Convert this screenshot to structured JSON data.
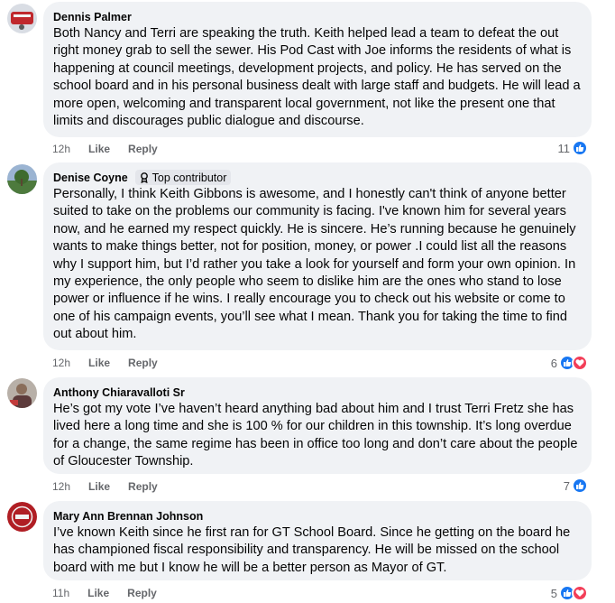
{
  "comments": [
    {
      "author": "Dennis Palmer",
      "badge": "",
      "text": "Both Nancy and Terri are speaking the truth. Keith helped lead a team to defeat the out right money grab to sell the sewer. His Pod Cast with Joe informs the residents of what is happening at council meetings, development projects, and policy. He has served on the school board and in his personal business dealt with large staff and budgets. He will lead a more open, welcoming and transparent local government, not like the present one that limits and discourages public dialogue and discourse.",
      "time": "12h",
      "like_label": "Like",
      "reply_label": "Reply",
      "reaction_count": "11",
      "reactions": [
        "like-icon"
      ]
    },
    {
      "author": "Denise Coyne",
      "badge": "Top contributor",
      "text": "Personally, I think Keith Gibbons is awesome, and I honestly can't think of anyone better suited to take on the problems our community is facing. I've known him for several years now, and he earned my respect quickly. He is sincere. He’s running because he genuinely wants to make things better, not for position, money, or power .I could list all the reasons why I support him, but I’d rather you take a look for yourself and form your own opinion. In my experience, the only people who seem to dislike him are the ones who stand to lose power or influence if he wins. I really encourage you to check out his website or come to one of his campaign events, you’ll see what I mean. Thank you for taking the time to find out about him.",
      "time": "12h",
      "like_label": "Like",
      "reply_label": "Reply",
      "reaction_count": "6",
      "reactions": [
        "like-icon",
        "love-icon"
      ]
    },
    {
      "author": "Anthony Chiaravalloti Sr",
      "badge": "",
      "text": "He’s got my vote I’ve haven’t heard anything bad about him and I trust Terri Fretz she has lived here a long time and she is 100 % for our children in this township. It’s long overdue for a change, the same regime has been in office too long and don’t care about the people of Gloucester Township.",
      "time": "12h",
      "like_label": "Like",
      "reply_label": "Reply",
      "reaction_count": "7",
      "reactions": [
        "like-icon"
      ]
    },
    {
      "author": "Mary Ann Brennan Johnson",
      "badge": "",
      "text": "I’ve known Keith since he first ran for GT School Board. Since he getting on the board he has championed fiscal responsibility and transparency. He will be missed on the school board with me but I know he will be a better person as Mayor of GT.",
      "time": "11h",
      "like_label": "Like",
      "reply_label": "Reply",
      "reaction_count": "5",
      "reactions": [
        "like-icon",
        "love-icon"
      ]
    }
  ],
  "colors": {
    "bubble": "#f0f2f5",
    "meta": "#65676b",
    "like_blue": "#1877f2",
    "love_red": "#f33e58"
  }
}
